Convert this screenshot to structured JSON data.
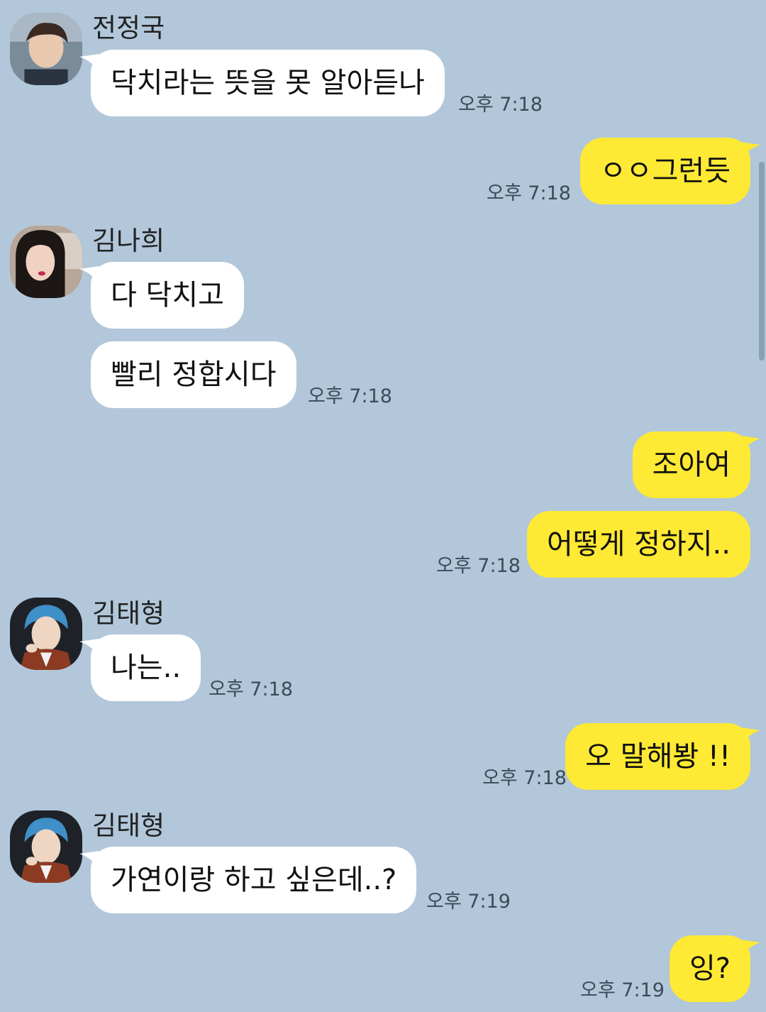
{
  "messages": [
    {
      "sender": "전정국",
      "text": "닥치라는 뜻을 못 알아듣나",
      "time": "오후 7:18"
    },
    {
      "text": "ㅇㅇ그런듯",
      "time": "오후 7:18"
    },
    {
      "sender": "김나희",
      "text": "다 닥치고"
    },
    {
      "text": "빨리 정합시다",
      "time": "오후 7:18"
    },
    {
      "text": "조아여"
    },
    {
      "text": "어떻게 정하지..",
      "time": "오후 7:18"
    },
    {
      "sender": "김태형",
      "text": "나는..",
      "time": "오후 7:18"
    },
    {
      "text": "오 말해봥 !!",
      "time": "오후 7:18"
    },
    {
      "sender": "김태형",
      "text": "가연이랑 하고 싶은데..?",
      "time": "오후 7:19"
    },
    {
      "text": "잉?",
      "time": "오후 7:19"
    }
  ],
  "colors": {
    "background": "#b2c7da",
    "incoming_bubble": "#ffffff",
    "outgoing_bubble": "#fee934"
  }
}
